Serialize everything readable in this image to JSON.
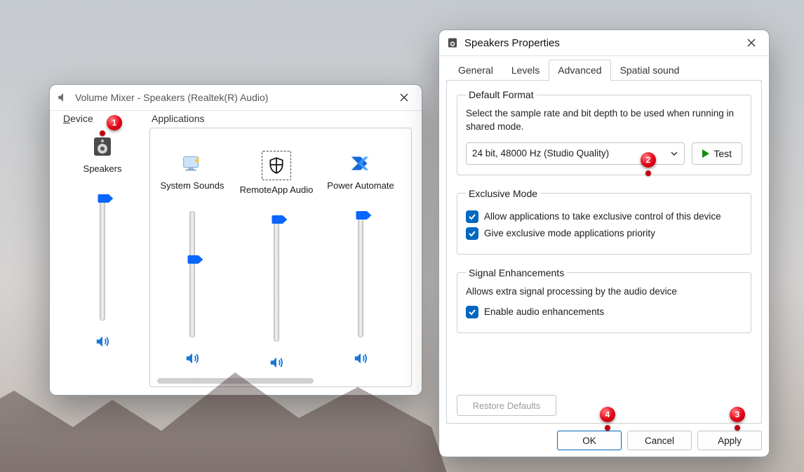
{
  "mixer": {
    "title": "Volume Mixer - Speakers (Realtek(R) Audio)",
    "device_section_label": "Device",
    "apps_section_label": "Applications",
    "device": {
      "label": "Speakers",
      "volume_pct": 100
    },
    "apps": [
      {
        "label": "System Sounds",
        "icon": "system-sounds-icon",
        "volume_pct": 65
      },
      {
        "label": "RemoteApp Audio",
        "icon": "shield-icon",
        "volume_pct": 100
      },
      {
        "label": "Power Automate",
        "icon": "power-automate-icon",
        "volume_pct": 100
      }
    ]
  },
  "props": {
    "title": "Speakers Properties",
    "tabs": {
      "general": "General",
      "levels": "Levels",
      "advanced": "Advanced",
      "spatial": "Spatial sound"
    },
    "active_tab": "advanced",
    "default_format": {
      "legend": "Default Format",
      "hint": "Select the sample rate and bit depth to be used when running in shared mode.",
      "selected": "24 bit, 48000 Hz (Studio Quality)",
      "test_label": "Test"
    },
    "exclusive": {
      "legend": "Exclusive Mode",
      "allow_label": "Allow applications to take exclusive control of this device",
      "allow_checked": true,
      "priority_label": "Give exclusive mode applications priority",
      "priority_checked": true
    },
    "signal": {
      "legend": "Signal Enhancements",
      "hint": "Allows extra signal processing by the audio device",
      "enable_label": "Enable audio enhancements",
      "enable_checked": true
    },
    "restore_label": "Restore Defaults",
    "ok_label": "OK",
    "cancel_label": "Cancel",
    "apply_label": "Apply"
  },
  "annotations": {
    "one": "1",
    "two": "2",
    "three": "3",
    "four": "4"
  }
}
